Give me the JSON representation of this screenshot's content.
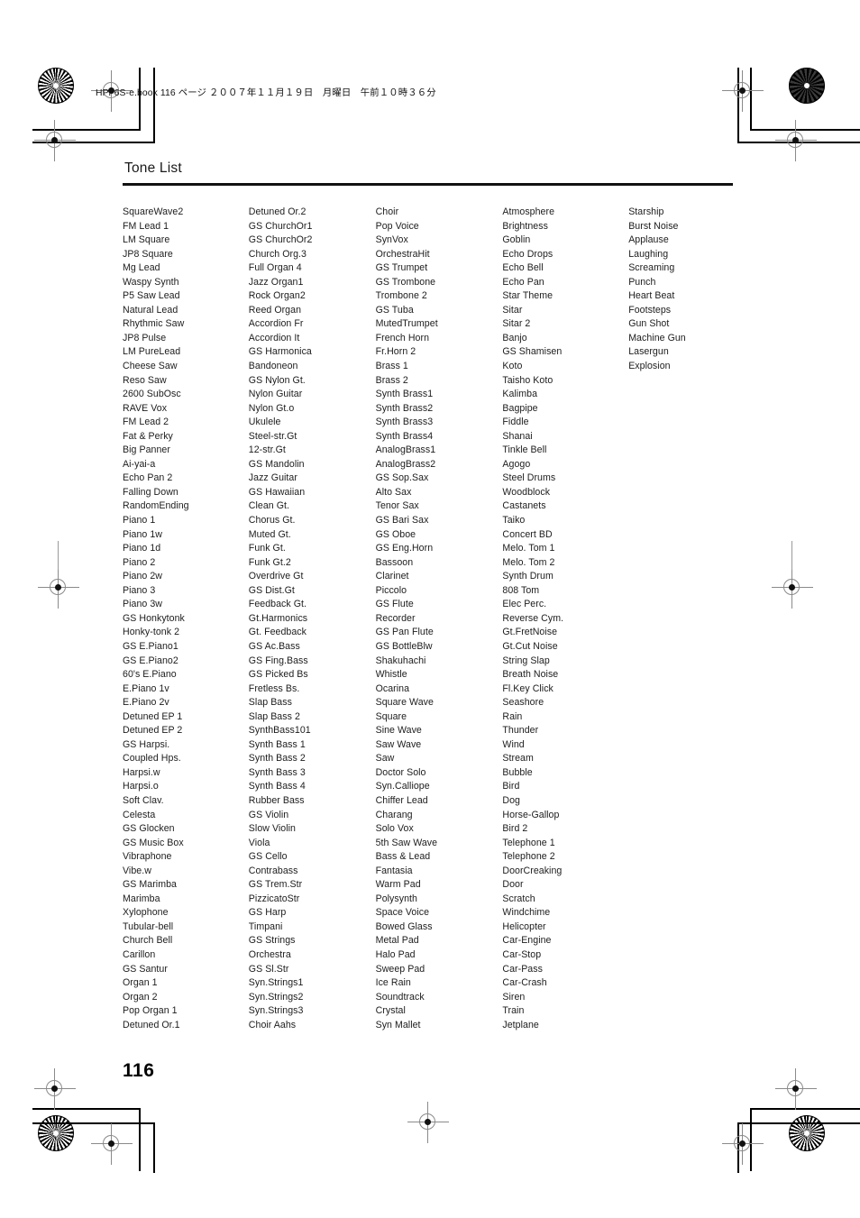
{
  "header": {
    "file_info": "HPi-6S-e.book  116 ページ  ２００７年１１月１９日　月曜日　午前１０時３６分"
  },
  "page": {
    "title": "Tone List",
    "number": "116"
  },
  "columns": [
    {
      "id": "column-1",
      "items": [
        "SquareWave2",
        "FM Lead 1",
        "LM Square",
        "JP8 Square",
        "Mg Lead",
        "Waspy Synth",
        "P5 Saw Lead",
        "Natural Lead",
        "Rhythmic Saw",
        "JP8 Pulse",
        "LM PureLead",
        "Cheese Saw",
        "Reso Saw",
        "2600 SubOsc",
        "RAVE Vox",
        "FM Lead 2",
        "Fat & Perky",
        "Big Panner",
        "Ai-yai-a",
        "Echo Pan 2",
        "Falling Down",
        "RandomEnding",
        "Piano 1",
        "Piano 1w",
        "Piano 1d",
        "Piano 2",
        "Piano 2w",
        "Piano 3",
        "Piano 3w",
        "GS Honkytonk",
        "Honky-tonk 2",
        "GS E.Piano1",
        "GS E.Piano2",
        "60's E.Piano",
        "E.Piano 1v",
        "E.Piano 2v",
        "Detuned EP 1",
        "Detuned EP 2",
        "GS Harpsi.",
        "Coupled Hps.",
        "Harpsi.w",
        "Harpsi.o",
        "Soft Clav.",
        "Celesta",
        "GS Glocken",
        "GS Music Box",
        "Vibraphone",
        "Vibe.w",
        "GS Marimba",
        "Marimba",
        "Xylophone",
        "Tubular-bell",
        "Church Bell",
        "Carillon",
        "GS Santur",
        "Organ 1",
        "Organ 2",
        "Pop Organ 1",
        "Detuned Or.1"
      ]
    },
    {
      "id": "column-2",
      "items": [
        "Detuned Or.2",
        "GS ChurchOr1",
        "GS ChurchOr2",
        "Church Org.3",
        "Full Organ 4",
        "Jazz Organ1",
        "Rock Organ2",
        "Reed Organ",
        "Accordion Fr",
        "Accordion It",
        "GS Harmonica",
        "Bandoneon",
        "GS Nylon Gt.",
        "Nylon Guitar",
        "Nylon Gt.o",
        "Ukulele",
        "Steel-str.Gt",
        "12-str.Gt",
        "GS Mandolin",
        "Jazz Guitar",
        "GS Hawaiian",
        "Clean Gt.",
        "Chorus Gt.",
        "Muted Gt.",
        "Funk Gt.",
        "Funk Gt.2",
        "Overdrive Gt",
        "GS Dist.Gt",
        "Feedback Gt.",
        "Gt.Harmonics",
        "Gt. Feedback",
        "GS Ac.Bass",
        "GS Fing.Bass",
        "GS Picked Bs",
        "Fretless Bs.",
        "Slap Bass",
        "Slap Bass 2",
        "SynthBass101",
        "Synth Bass 1",
        "Synth Bass 2",
        "Synth Bass 3",
        "Synth Bass 4",
        "Rubber Bass",
        "GS Violin",
        "Slow Violin",
        "Viola",
        "GS Cello",
        "Contrabass",
        "GS Trem.Str",
        "PizzicatoStr",
        "GS Harp",
        "Timpani",
        "GS Strings",
        "Orchestra",
        "GS Sl.Str",
        "Syn.Strings1",
        "Syn.Strings2",
        "Syn.Strings3",
        "Choir Aahs"
      ]
    },
    {
      "id": "column-3",
      "items": [
        "Choir",
        "Pop Voice",
        "SynVox",
        "OrchestraHit",
        "GS Trumpet",
        "GS Trombone",
        "Trombone 2",
        "GS Tuba",
        "MutedTrumpet",
        "French Horn",
        "Fr.Horn 2",
        "Brass 1",
        "Brass 2",
        "Synth Brass1",
        "Synth Brass2",
        "Synth Brass3",
        "Synth Brass4",
        "AnalogBrass1",
        "AnalogBrass2",
        "GS Sop.Sax",
        "Alto Sax",
        "Tenor Sax",
        "GS Bari Sax",
        "GS Oboe",
        "GS Eng.Horn",
        "Bassoon",
        "Clarinet",
        "Piccolo",
        "GS Flute",
        "Recorder",
        "GS Pan Flute",
        "GS BottleBlw",
        "Shakuhachi",
        "Whistle",
        "Ocarina",
        "Square Wave",
        "Square",
        "Sine Wave",
        "Saw Wave",
        "Saw",
        "Doctor Solo",
        "Syn.Calliope",
        "Chiffer Lead",
        "Charang",
        "Solo Vox",
        "5th Saw Wave",
        "Bass & Lead",
        "Fantasia",
        "Warm Pad",
        "Polysynth",
        "Space Voice",
        "Bowed Glass",
        "Metal Pad",
        "Halo Pad",
        "Sweep Pad",
        "Ice Rain",
        "Soundtrack",
        "Crystal",
        "Syn Mallet"
      ]
    },
    {
      "id": "column-4",
      "items": [
        "Atmosphere",
        "Brightness",
        "Goblin",
        "Echo Drops",
        "Echo Bell",
        "Echo Pan",
        "Star Theme",
        "Sitar",
        "Sitar 2",
        "Banjo",
        "GS Shamisen",
        "Koto",
        "Taisho Koto",
        "Kalimba",
        "Bagpipe",
        "Fiddle",
        "Shanai",
        "Tinkle Bell",
        "Agogo",
        "Steel Drums",
        "Woodblock",
        "Castanets",
        "Taiko",
        "Concert BD",
        "Melo. Tom 1",
        "Melo. Tom 2",
        "Synth Drum",
        "808 Tom",
        "Elec Perc.",
        "Reverse Cym.",
        "Gt.FretNoise",
        "Gt.Cut Noise",
        "String Slap",
        "Breath Noise",
        "Fl.Key Click",
        "Seashore",
        "Rain",
        "Thunder",
        "Wind",
        "Stream",
        "Bubble",
        "Bird",
        "Dog",
        "Horse-Gallop",
        "Bird 2",
        "Telephone 1",
        "Telephone 2",
        "DoorCreaking",
        "Door",
        "Scratch",
        "Windchime",
        "Helicopter",
        "Car-Engine",
        "Car-Stop",
        "Car-Pass",
        "Car-Crash",
        "Siren",
        "Train",
        "Jetplane"
      ]
    },
    {
      "id": "column-5",
      "items": [
        "Starship",
        "Burst Noise",
        "Applause",
        "Laughing",
        "Screaming",
        "Punch",
        "Heart Beat",
        "Footsteps",
        "Gun Shot",
        "Machine Gun",
        "Lasergun",
        "Explosion"
      ]
    }
  ],
  "colors": {
    "text": "#1a1a1a",
    "rule": "#111111",
    "mark": "#8a8a8a",
    "page_background": "#ffffff"
  }
}
